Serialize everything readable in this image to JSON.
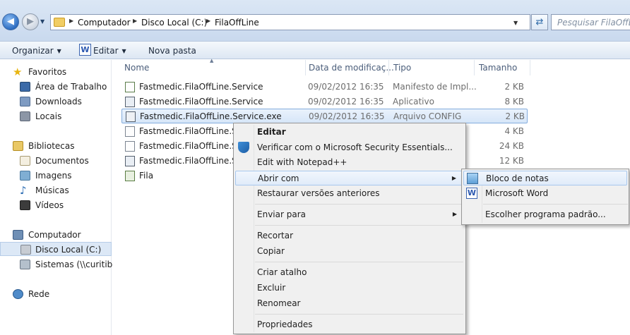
{
  "addressbar": {
    "path": [
      "Computador",
      "Disco Local (C:)",
      "FilaOffLine"
    ],
    "search_placeholder": "Pesquisar FilaOffLine"
  },
  "toolbar": {
    "organize_label": "Organizar",
    "edit_label": "Editar",
    "new_folder_label": "Nova pasta"
  },
  "navpane": {
    "favorites": "Favoritos",
    "desktop": "Área de Trabalho",
    "downloads": "Downloads",
    "places": "Locais",
    "libraries": "Bibliotecas",
    "documents": "Documentos",
    "images": "Imagens",
    "music": "Músicas",
    "videos": "Vídeos",
    "computer": "Computador",
    "local_disk": "Disco Local (C:)",
    "network_drive": "Sistemas (\\\\curitiba)",
    "network": "Rede"
  },
  "columns": {
    "name": "Nome",
    "date": "Data de modificaç...",
    "type": "Tipo",
    "size": "Tamanho"
  },
  "files": [
    {
      "name": "Fastmedic.FilaOffLine.Service",
      "date": "09/02/2012 16:35",
      "type": "Manifesto de Impl...",
      "size": "2 KB"
    },
    {
      "name": "Fastmedic.FilaOffLine.Service",
      "date": "09/02/2012 16:35",
      "type": "Aplicativo",
      "size": "8 KB"
    },
    {
      "name": "Fastmedic.FilaOffLine.Service.exe",
      "date": "09/02/2012 16:35",
      "type": "Arquivo CONFIG",
      "size": "2 KB"
    },
    {
      "name": "Fastmedic.FilaOffLine.Ser",
      "date": "",
      "type": "",
      "size": "4 KB"
    },
    {
      "name": "Fastmedic.FilaOffLine.Ser",
      "date": "",
      "type": "",
      "size": "24 KB"
    },
    {
      "name": "Fastmedic.FilaOffLine.Ser",
      "date": "",
      "type": "",
      "size": "12 KB"
    },
    {
      "name": "Fila",
      "date": "",
      "type": "",
      "size": ""
    }
  ],
  "context_menu": {
    "edit": "Editar",
    "scan": "Verificar com o Microsoft Security Essentials...",
    "notepadpp": "Edit with Notepad++",
    "open_with": "Abrir com",
    "restore": "Restaurar versões anteriores",
    "send_to": "Enviar para",
    "cut": "Recortar",
    "copy": "Copiar",
    "create_shortcut": "Criar atalho",
    "delete": "Excluir",
    "rename": "Renomear",
    "properties": "Propriedades"
  },
  "submenu": {
    "notepad": "Bloco de notas",
    "word": "Microsoft Word",
    "choose_default": "Escolher programa padrão..."
  }
}
